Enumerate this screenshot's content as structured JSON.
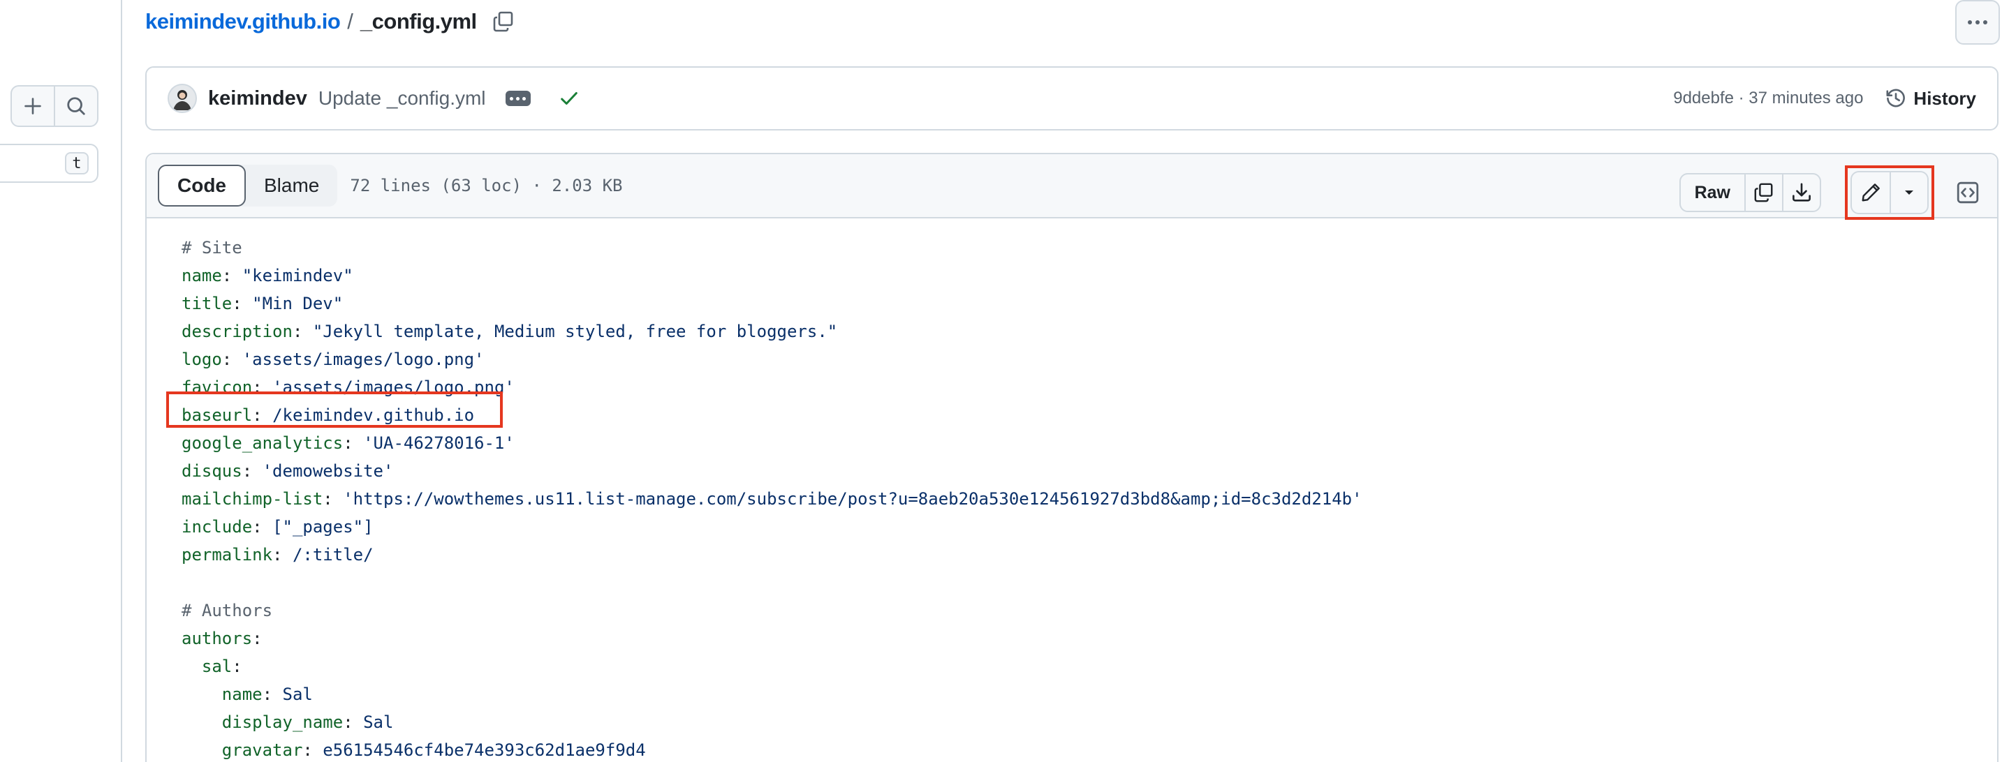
{
  "breadcrumb": {
    "repo": "keimindev.github.io",
    "separator": "/",
    "file": "_config.yml"
  },
  "sidebar": {
    "filter_shortcut": "t"
  },
  "commit": {
    "author": "keimindev",
    "message": "Update _config.yml",
    "sha_time": "9ddebfe · 37 minutes ago",
    "history_label": "History"
  },
  "file_header": {
    "tab_code": "Code",
    "tab_blame": "Blame",
    "meta": "72 lines (63 loc) · 2.03 KB",
    "raw_label": "Raw"
  },
  "colors": {
    "accent": "#0969da",
    "highlight": "#e5371f",
    "success": "#1a7f37"
  },
  "code_lines": [
    {
      "comment": "# Site"
    },
    {
      "key": "name",
      "value": "\"keimindev\""
    },
    {
      "key": "title",
      "value": "\"Min Dev\""
    },
    {
      "key": "description",
      "value": "\"Jekyll template, Medium styled, free for bloggers.\""
    },
    {
      "key": "logo",
      "value": "'assets/images/logo.png'"
    },
    {
      "key": "favicon",
      "value": "'assets/images/logo.png'"
    },
    {
      "key": "baseurl",
      "value": "/keimindev.github.io"
    },
    {
      "key": "google_analytics",
      "value": "'UA-46278016-1'"
    },
    {
      "key": "disqus",
      "value": "'demowebsite'"
    },
    {
      "key": "mailchimp-list",
      "value": "'https://wowthemes.us11.list-manage.com/subscribe/post?u=8aeb20a530e124561927d3bd8&amp;id=8c3d2d214b'"
    },
    {
      "key": "include",
      "value": "[\"_pages\"]"
    },
    {
      "key": "permalink",
      "value": "/:title/"
    },
    {
      "blank": ""
    },
    {
      "comment": "# Authors"
    },
    {
      "key": "authors",
      "value": ""
    },
    {
      "indent": "  ",
      "key": "sal",
      "value": ""
    },
    {
      "indent": "    ",
      "key": "name",
      "value": "Sal"
    },
    {
      "indent": "    ",
      "key": "display_name",
      "value": "Sal"
    },
    {
      "indent": "    ",
      "key": "gravatar",
      "value": "e56154546cf4be74e393c62d1ae9f9d4"
    }
  ]
}
